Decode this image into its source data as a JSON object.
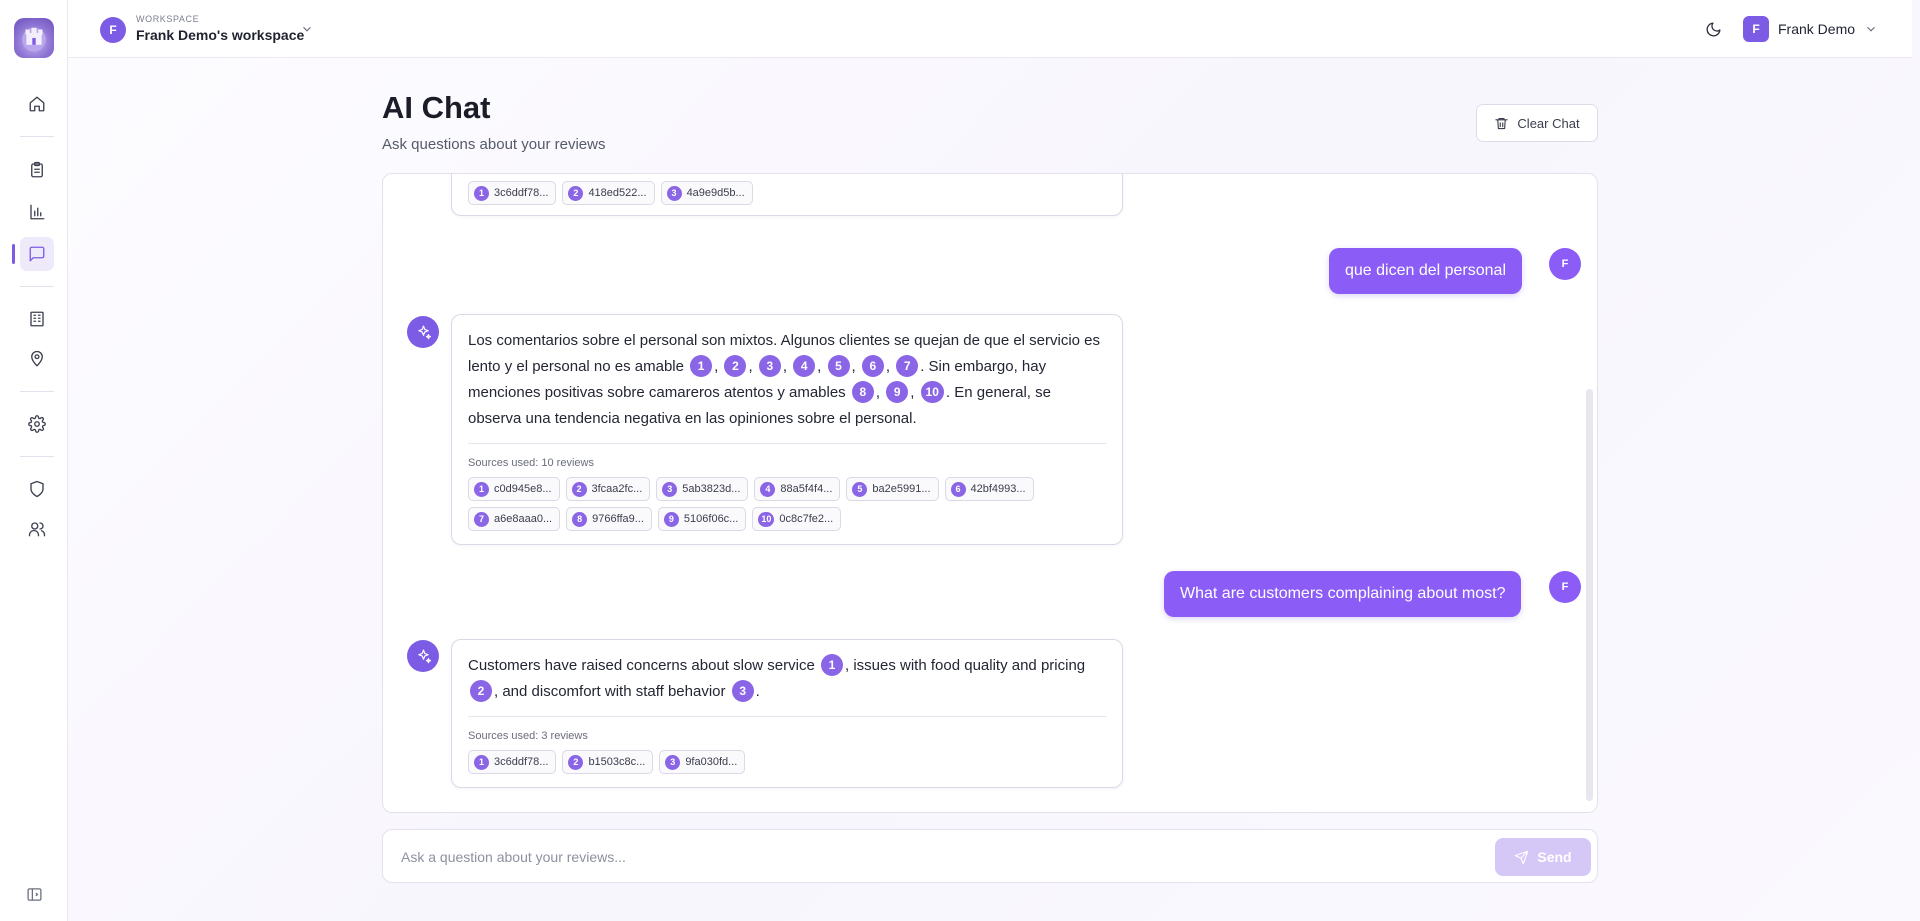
{
  "workspace": {
    "label": "WORKSPACE",
    "initial": "F",
    "name": "Frank Demo's workspace"
  },
  "user": {
    "initial": "F",
    "name": "Frank Demo"
  },
  "header": {
    "title": "AI Chat",
    "subtitle": "Ask questions about your reviews",
    "clear_label": "Clear Chat"
  },
  "sidebar": {
    "items": [
      {
        "icon": "home-icon"
      },
      {
        "icon": "clipboard-icon"
      },
      {
        "icon": "bar-chart-icon"
      },
      {
        "icon": "chat-icon",
        "active": true
      },
      {
        "icon": "building-icon"
      },
      {
        "icon": "map-pin-icon"
      },
      {
        "icon": "gear-icon"
      },
      {
        "icon": "shield-icon"
      },
      {
        "icon": "users-icon"
      }
    ]
  },
  "messages": {
    "partial_sources": [
      "3c6ddf78...",
      "418ed522...",
      "4a9e9d5b..."
    ],
    "user1": {
      "text": "que dicen del personal",
      "avatar": "F"
    },
    "ai1": {
      "t0": "Los comentarios sobre el personal son mixtos. Algunos clientes se quejan de que el servicio es lento y el personal no es amable ",
      "t1": ". Sin embargo, hay menciones positivas sobre camareros atentos y amables ",
      "t2": ". En general, se observa una tendencia negativa en las opiniones sobre el personal.",
      "sources_label": "Sources used: 10 reviews",
      "sources": [
        "c0d945e8...",
        "3fcaa2fc...",
        "5ab3823d...",
        "88a5f4f4...",
        "ba2e5991...",
        "42bf4993...",
        "a6e8aaa0...",
        "9766ffa9...",
        "5106f06c...",
        "0c8c7fe2..."
      ]
    },
    "user2": {
      "text": "What are customers complaining about most?",
      "avatar": "F"
    },
    "ai2": {
      "t0": "Customers have raised concerns about slow service ",
      "t1": ", issues with food quality and pricing ",
      "t2": ", and discomfort with staff behavior ",
      "t3": ".",
      "sources_label": "Sources used: 3 reviews",
      "sources": [
        "3c6ddf78...",
        "b1503c8c...",
        "9fa030fd..."
      ]
    }
  },
  "input": {
    "placeholder": "Ask a question about your reviews...",
    "value": "",
    "send_label": "Send"
  },
  "colors": {
    "accent": "#7c5ce4",
    "bubble": "#8b5cf6",
    "send_disabled": "#d5c8f7"
  }
}
